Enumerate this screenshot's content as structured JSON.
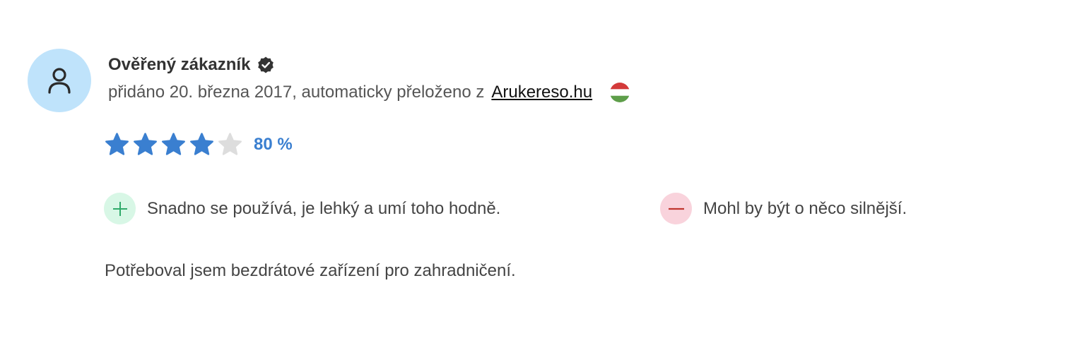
{
  "reviewer": {
    "name": "Ověřený zákazník",
    "avatar_icon": "user-icon",
    "verified_icon": "verified-check-icon"
  },
  "meta": {
    "prefix": "přidáno 20. března 2017, automaticky přeloženo z",
    "source": "Arukereso.hu",
    "flag_icon": "hungary-flag-icon"
  },
  "rating": {
    "stars_filled": 4,
    "stars_total": 5,
    "percent_label": "80 %",
    "colors": {
      "filled": "#3a7fd0",
      "empty": "#dddddd"
    }
  },
  "pros": {
    "icon": "plus-icon",
    "text": "Snadno se používá, je lehký a umí toho hodně."
  },
  "cons": {
    "icon": "minus-icon",
    "text": "Mohl by být o něco silnější."
  },
  "review": {
    "text": "Potřeboval jsem bezdrátové zařízení pro zahradničení."
  }
}
